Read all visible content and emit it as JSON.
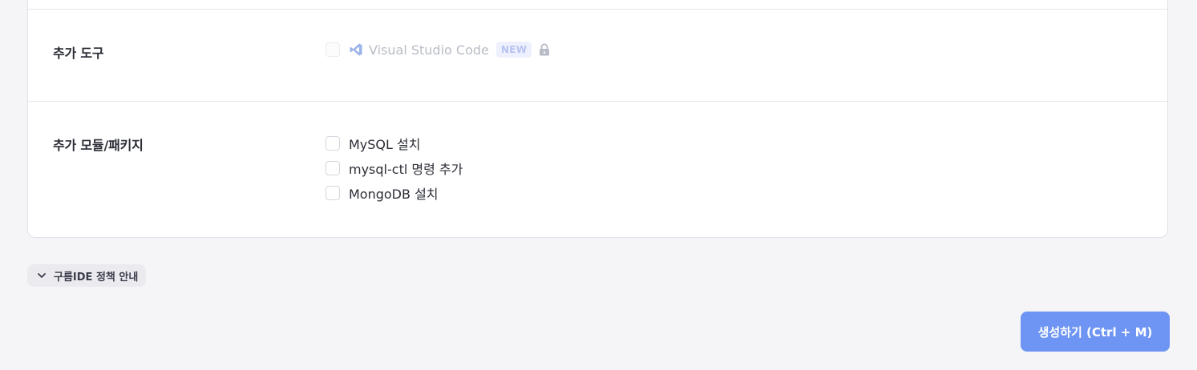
{
  "form": {
    "tools": {
      "label": "추가 도구",
      "options": [
        {
          "label": "Visual Studio Code",
          "badge": "NEW",
          "checked": false,
          "disabled": true,
          "locked": true,
          "icon": "vscode-icon"
        }
      ]
    },
    "modules": {
      "label": "추가 모듈/패키지",
      "options": [
        {
          "label": "MySQL 설치",
          "checked": false
        },
        {
          "label": "mysql-ctl 명령 추가",
          "checked": false
        },
        {
          "label": "MongoDB 설치",
          "checked": false
        }
      ]
    }
  },
  "policy": {
    "label": "구름IDE 정책 안내",
    "icon": "chevron-down-icon"
  },
  "actions": {
    "create_label": "생성하기 (Ctrl + M)"
  },
  "colors": {
    "primary_button": "#6e95f3",
    "badge_bg": "#eef1fd",
    "badge_text": "#b7c3f3",
    "page_bg": "#f5f5f7",
    "card_bg": "#ffffff"
  }
}
